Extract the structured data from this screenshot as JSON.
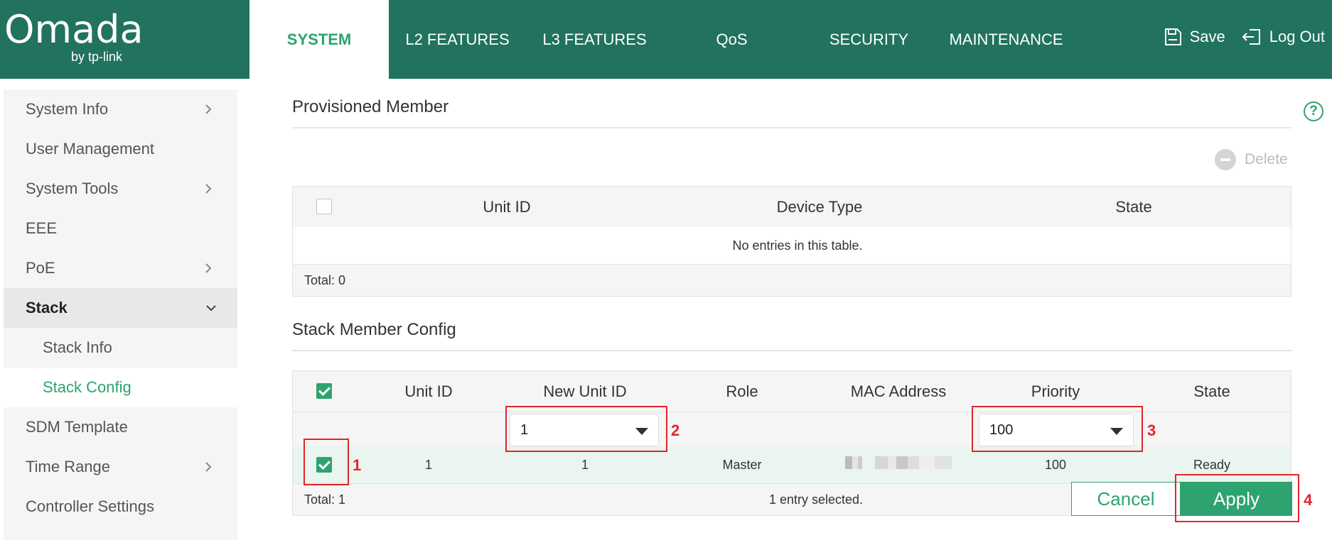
{
  "header": {
    "brand": "Omada",
    "brand_sub": "by tp-link",
    "nav": [
      {
        "label": "SYSTEM",
        "active": true
      },
      {
        "label": "L2 FEATURES"
      },
      {
        "label": "L3 FEATURES"
      },
      {
        "label": "QoS"
      },
      {
        "label": "SECURITY"
      },
      {
        "label": "MAINTENANCE"
      }
    ],
    "save_label": "Save",
    "logout_label": "Log Out"
  },
  "sidebar": {
    "items": [
      {
        "label": "System Info",
        "chevron": "right"
      },
      {
        "label": "User Management"
      },
      {
        "label": "System Tools",
        "chevron": "right"
      },
      {
        "label": "EEE"
      },
      {
        "label": "PoE",
        "chevron": "right"
      },
      {
        "label": "Stack",
        "chevron": "down",
        "active": true
      },
      {
        "label": "Stack Info",
        "sub": true
      },
      {
        "label": "Stack Config",
        "sub": true,
        "selected": true
      },
      {
        "label": "SDM Template"
      },
      {
        "label": "Time Range",
        "chevron": "right"
      },
      {
        "label": "Controller Settings"
      }
    ]
  },
  "provisioned": {
    "title": "Provisioned Member",
    "delete_label": "Delete",
    "columns": [
      "Unit ID",
      "Device Type",
      "State"
    ],
    "empty_text": "No entries in this table.",
    "total": "Total: 0"
  },
  "stack_config": {
    "title": "Stack Member Config",
    "columns": [
      "Unit ID",
      "New Unit ID",
      "Role",
      "MAC Address",
      "Priority",
      "State"
    ],
    "new_unit_id_select": "1",
    "priority_select": "100",
    "row": {
      "unit_id": "1",
      "new_unit_id": "1",
      "role": "Master",
      "priority": "100",
      "state": "Ready"
    },
    "total": "Total: 1",
    "selected_text": "1 entry selected.",
    "cancel_label": "Cancel",
    "apply_label": "Apply"
  },
  "markers": [
    "1",
    "2",
    "3",
    "4"
  ],
  "colors": {
    "header": "#21725e",
    "accent": "#2ea36f",
    "annotation": "#e0262b"
  }
}
